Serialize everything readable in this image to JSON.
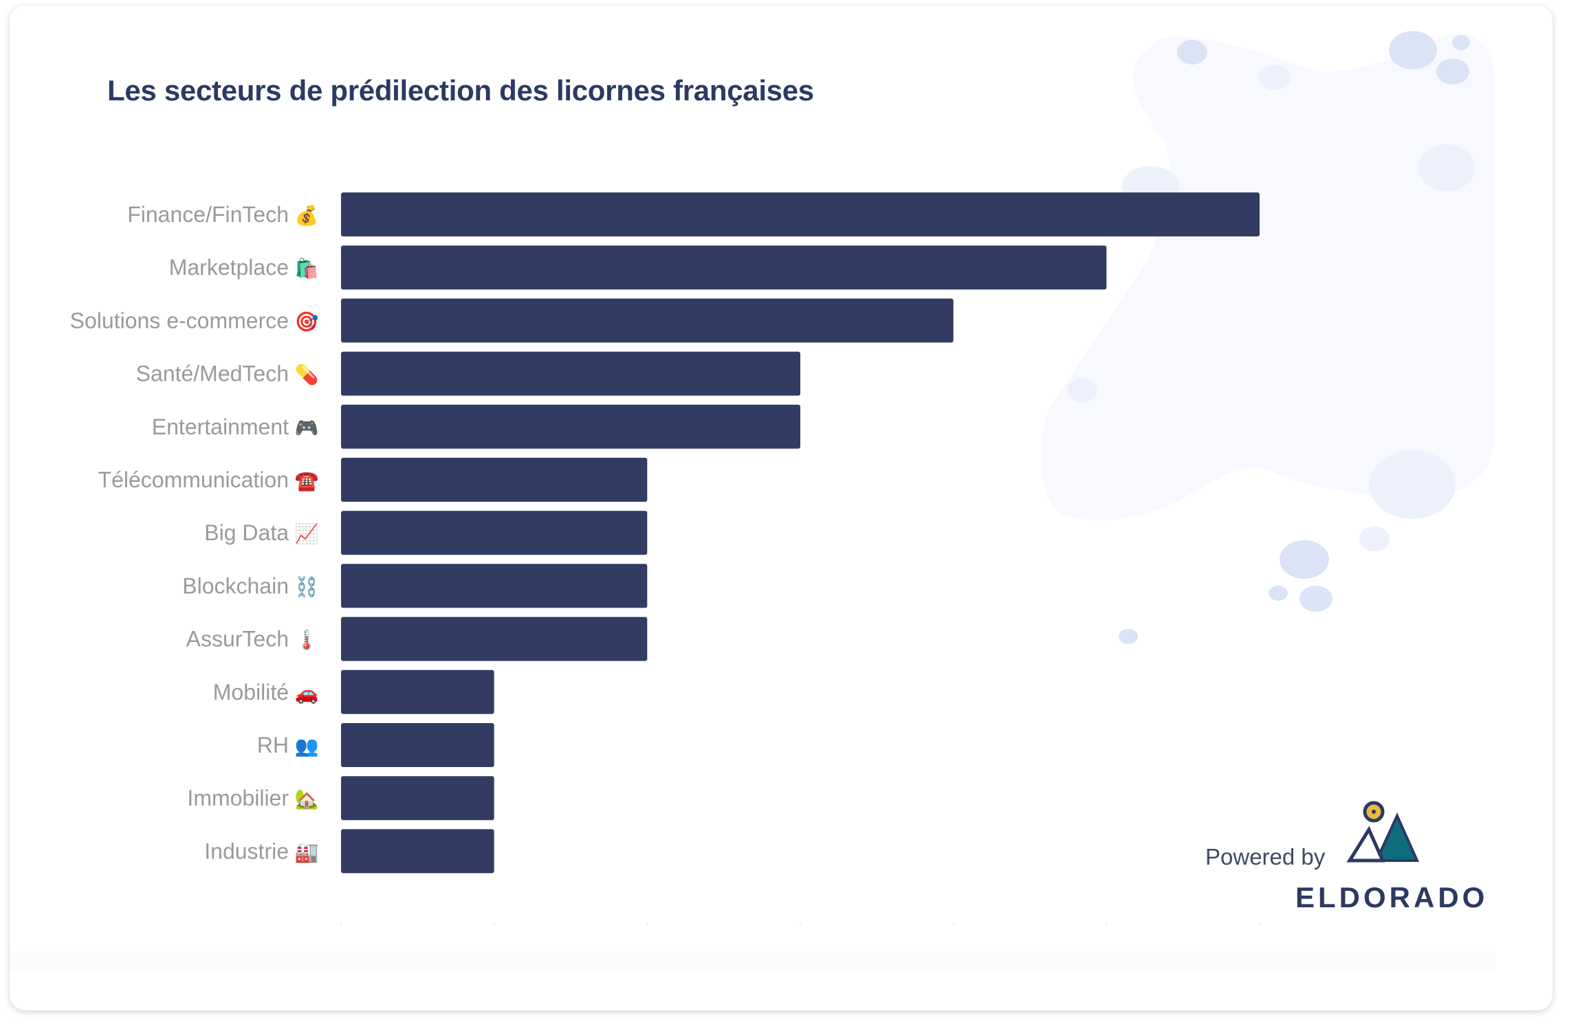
{
  "card": {
    "title": "Les secteurs de prédilection des licornes françaises",
    "powered_by": "Powered by",
    "brand": "ELDORADO"
  },
  "colors": {
    "bar": "#323c62",
    "title": "#2c3a62",
    "label": "#9a9a9a",
    "blob": "#f8f9fe",
    "bubble": "#dbe3f6",
    "logo_teal": "#0f6b7e",
    "logo_sun": "#e9b940",
    "logo_navy": "#2c3a62"
  },
  "chart_data": {
    "type": "bar",
    "orientation": "horizontal",
    "title": "Les secteurs de prédilection des licornes françaises",
    "xlabel": "",
    "ylabel": "",
    "xlim": [
      0,
      6
    ],
    "grid": false,
    "categories": [
      "Finance/FinTech",
      "Marketplace",
      "Solutions e-commerce",
      "Santé/MedTech",
      "Entertainment",
      "Télécommunication",
      "Big Data",
      "Blockchain",
      "AssurTech",
      "Mobilité",
      "RH",
      "Immobilier",
      "Industrie"
    ],
    "icons": [
      "💰",
      "🛍️",
      "🎯",
      "💊",
      "🎮",
      "☎️",
      "📈",
      "⛓️",
      "🌡️",
      "🚗",
      "👥",
      "🏡",
      "🏭"
    ],
    "icon_names": [
      "money-bag-icon",
      "shopping-bags-icon",
      "target-icon",
      "pill-icon",
      "gamepad-icon",
      "telephone-icon",
      "chart-increasing-icon",
      "chains-icon",
      "thermometer-icon",
      "car-icon",
      "people-icon",
      "house-icon",
      "factory-icon"
    ],
    "values": [
      6,
      5,
      4,
      3,
      3,
      2,
      2,
      2,
      2,
      1,
      1,
      1,
      1
    ]
  }
}
